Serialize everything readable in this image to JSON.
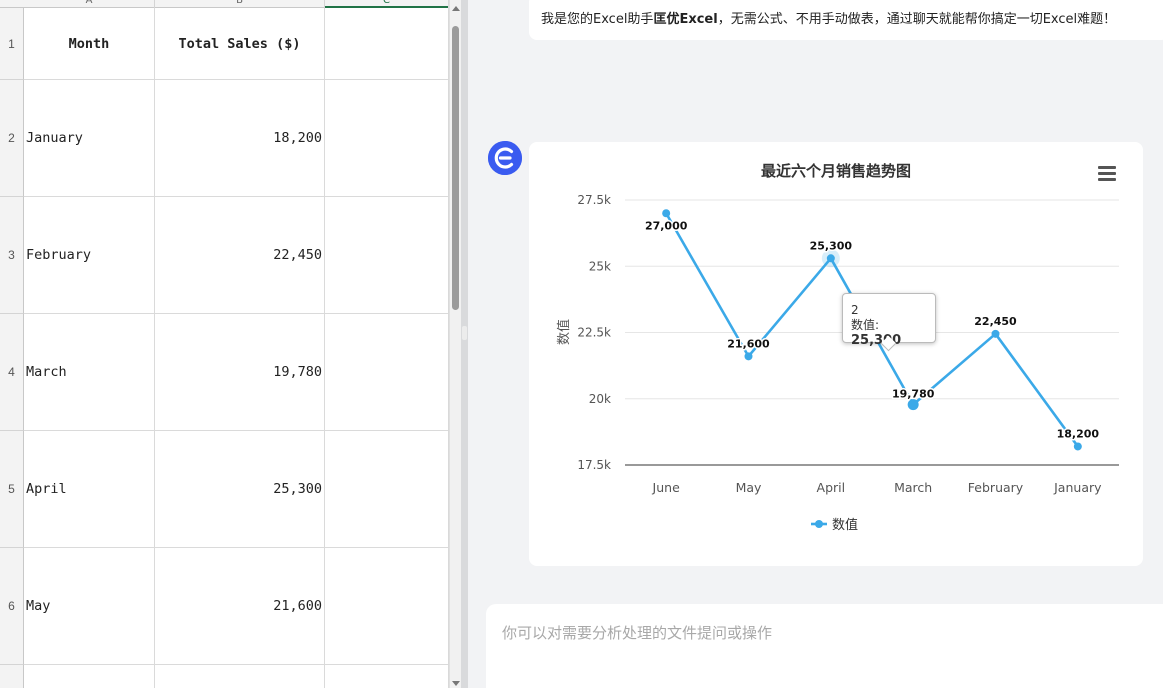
{
  "spreadsheet": {
    "columns": [
      "A",
      "B",
      "C"
    ],
    "header_row": {
      "row": "1",
      "month": "Month",
      "sales": "Total Sales ($)"
    },
    "rows": [
      {
        "row": "2",
        "month": "January",
        "sales": "18,200"
      },
      {
        "row": "3",
        "month": "February",
        "sales": "22,450"
      },
      {
        "row": "4",
        "month": "March",
        "sales": "19,780"
      },
      {
        "row": "5",
        "month": "April",
        "sales": "25,300"
      },
      {
        "row": "6",
        "month": "May",
        "sales": "21,600"
      }
    ]
  },
  "chat": {
    "intro_prefix": "我是您的Excel助手",
    "intro_brand": "匡优Excel",
    "intro_suffix": "，无需公式、不用手动做表，通过聊天就能帮你搞定一切Excel难题！",
    "input_placeholder": "你可以对需要分析处理的文件提问或操作"
  },
  "colors": {
    "series": "#3ba9e8",
    "avatar": "#3a5bf0",
    "excel_green": "#217346"
  },
  "icons": {
    "avatar": "excel-logo-icon",
    "menu": "hamburger-menu-icon"
  },
  "chart_data": {
    "type": "line",
    "title": "最近六个月销售趋势图",
    "xlabel": "",
    "ylabel": "数值",
    "categories": [
      "June",
      "May",
      "April",
      "March",
      "February",
      "January"
    ],
    "series": [
      {
        "name": "数值",
        "values": [
          27000,
          21600,
          25300,
          19780,
          22450,
          18200
        ]
      }
    ],
    "data_labels": [
      "27,000",
      "21,600",
      "25,300",
      "19,780",
      "22,450",
      "18,200"
    ],
    "yticks": [
      17500,
      20000,
      22500,
      25000,
      27500
    ],
    "ytick_labels": [
      "17.5k",
      "20k",
      "22.5k",
      "25k",
      "27.5k"
    ],
    "ylim": [
      17500,
      27500
    ],
    "grid": true,
    "legend": "bottom-center",
    "tooltip": {
      "index_label": "2",
      "series_label": "数值:",
      "value": "25,300"
    }
  }
}
